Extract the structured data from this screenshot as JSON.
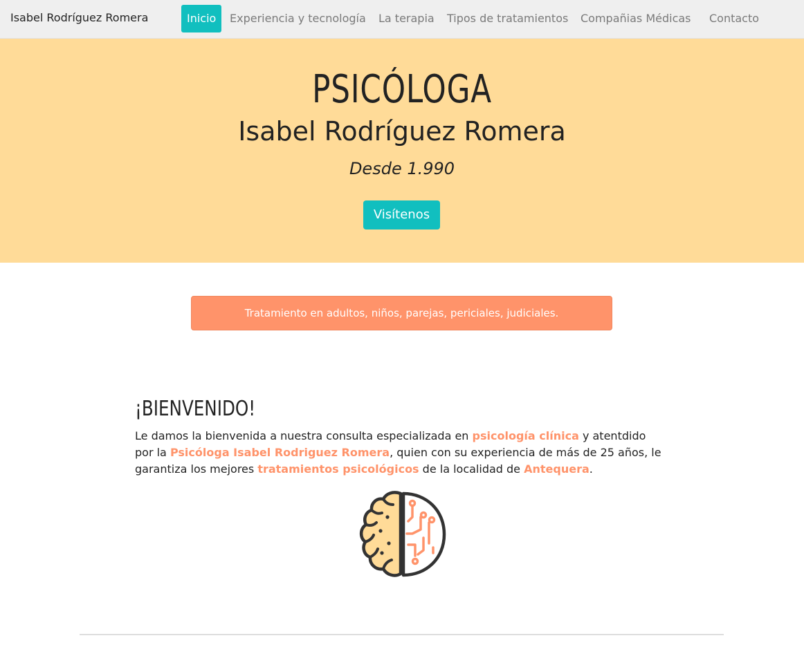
{
  "navbar": {
    "brand": "Isabel Rodríguez Romera",
    "items": [
      {
        "label": "Inicio",
        "active": true
      },
      {
        "label": "Experiencia y tecnología",
        "active": false
      },
      {
        "label": "La terapia",
        "active": false
      },
      {
        "label": "Tipos de tratamientos",
        "active": false
      },
      {
        "label": "Compañias Médicas",
        "active": false
      },
      {
        "label": "Contacto",
        "active": false
      }
    ]
  },
  "hero": {
    "title": "PSICÓLOGA",
    "name": "Isabel Rodríguez Romera",
    "since": "Desde 1.990",
    "button_label": "Visítenos",
    "background_color": "#ffdb98"
  },
  "banner": {
    "text": "Tratamiento en adultos, niños, parejas, periciales, judiciales.",
    "background_color": "#ff936a"
  },
  "welcome": {
    "heading": "¡BIENVENIDO!",
    "text_1": "Le damos la bienvenida a nuestra consulta especializada en ",
    "link_1": "psicología clínica",
    "text_2": " y atentdido por la ",
    "link_2": "Psicóloga Isabel Rodriguez Romera",
    "text_3": ", quien con su experiencia de más de 25 años, le garantiza los mejores ",
    "link_3": "tratamientos psicológicos",
    "text_4": " de la localidad de ",
    "link_4": "Antequera",
    "text_5": "."
  },
  "image": {
    "icon": "brain-circuit-icon"
  },
  "colors": {
    "accent": "#11bfbf",
    "highlight": "#ff936a",
    "hero_bg": "#ffdb98",
    "navbar_bg": "#efefef"
  }
}
